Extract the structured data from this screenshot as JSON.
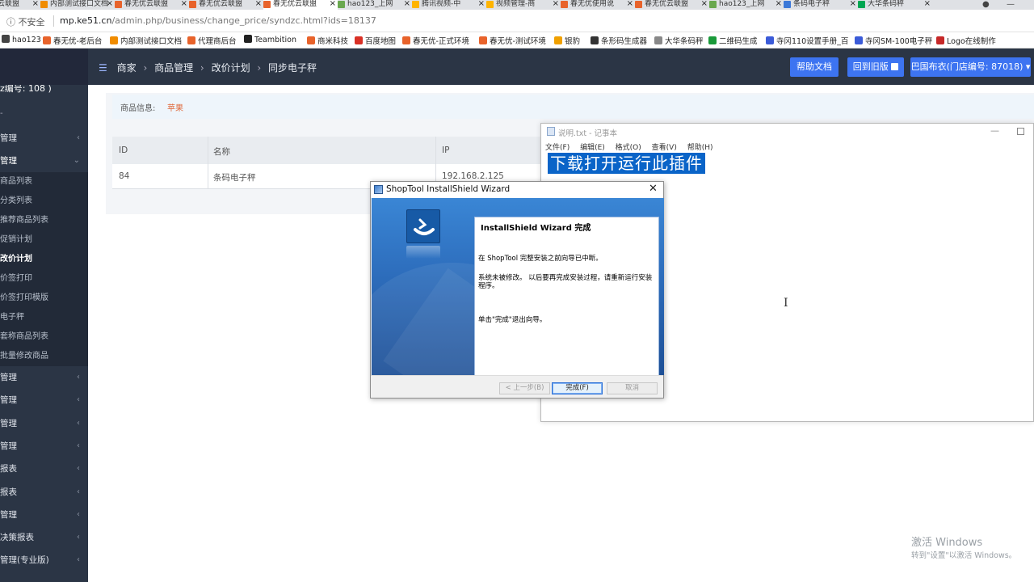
{
  "browser": {
    "tabs": [
      {
        "label": "春无优云联盟",
        "color": "#f08c00"
      },
      {
        "label": "内部测试接口文档",
        "color": "#f08c00"
      },
      {
        "label": "春无优云联盟",
        "color": "#e8632b"
      },
      {
        "label": "春无优云联盟",
        "color": "#e8632b"
      },
      {
        "label": "春无优云联盟",
        "color": "#e8632b",
        "active": true
      },
      {
        "label": "hao123_上网",
        "color": "#6aa84f"
      },
      {
        "label": "腾讯视频-中",
        "color": "#ffb400"
      },
      {
        "label": "视频管理-商",
        "color": "#ffb400"
      },
      {
        "label": "春无优使用说",
        "color": "#e8632b"
      },
      {
        "label": "春无优云联盟",
        "color": "#e8632b"
      },
      {
        "label": "hao123_上网",
        "color": "#6aa84f"
      },
      {
        "label": "条码电子秤",
        "color": "#3b78d8"
      },
      {
        "label": "大华条码秤",
        "color": "#00a651"
      }
    ],
    "address": {
      "security_label": "不安全",
      "url_host": "mp.ke51.cn",
      "url_path": "/admin.php/business/change_price/syndzc.html?ids=18137"
    },
    "bookmarks": [
      {
        "label": "hao123",
        "color": "#444"
      },
      {
        "label": "春无优-老后台",
        "color": "#e8632b"
      },
      {
        "label": "内部测试接口文档",
        "color": "#f08c00"
      },
      {
        "label": "代理商后台",
        "color": "#e8632b"
      },
      {
        "label": "Teambition",
        "color": "#222"
      },
      {
        "label": "商米科技",
        "color": "#e8632b"
      },
      {
        "label": "百度地图",
        "color": "#d93025"
      },
      {
        "label": "春无优-正式环境",
        "color": "#e8632b"
      },
      {
        "label": "春无优-测试环境",
        "color": "#e8632b"
      },
      {
        "label": "银豹",
        "color": "#f0a000"
      },
      {
        "label": "条形码生成器",
        "color": "#333"
      },
      {
        "label": "大华条码秤",
        "color": "#888"
      },
      {
        "label": "二维码生成",
        "color": "#1a9a3a"
      },
      {
        "label": "寺冈110设置手册_百",
        "color": "#3b5bd8"
      },
      {
        "label": "寺冈SM-100电子秤",
        "color": "#3b5bd8"
      },
      {
        "label": "Logo在线制作",
        "color": "#c62828"
      }
    ]
  },
  "header": {
    "breadcrumb": [
      "商家",
      "商品管理",
      "改价计划",
      "同步电子秤"
    ],
    "help_label": "帮助文档",
    "old_version_label": "回到旧版",
    "store_label": "巴国布衣(门店编号: 87018)"
  },
  "sidebar": {
    "store_id_label": "z编号: 108 )",
    "groups_top": [
      {
        "label": "管理"
      },
      {
        "label": "管理",
        "open": true
      }
    ],
    "sub_items": [
      {
        "label": "商品列表"
      },
      {
        "label": "分类列表"
      },
      {
        "label": "推荐商品列表"
      },
      {
        "label": "促销计划"
      },
      {
        "label": "改价计划",
        "active": true
      },
      {
        "label": "价签打印"
      },
      {
        "label": "价签打印模版"
      },
      {
        "label": "电子秤"
      },
      {
        "label": "套称商品列表"
      },
      {
        "label": "批量修改商品"
      }
    ],
    "groups_bottom": [
      {
        "label": "管理"
      },
      {
        "label": "管理"
      },
      {
        "label": "管理"
      },
      {
        "label": "管理"
      },
      {
        "label": "报表"
      },
      {
        "label": "报表"
      },
      {
        "label": "管理"
      },
      {
        "label": "决策报表"
      },
      {
        "label": "管理(专业版)"
      }
    ]
  },
  "main": {
    "product_info_label": "商品信息:",
    "product_info_value": "苹果",
    "table": {
      "columns": [
        "ID",
        "名称",
        "IP"
      ],
      "rows": [
        [
          "84",
          "条码电子秤",
          "192.168.2.125"
        ]
      ]
    }
  },
  "notepad": {
    "title": "说明.txt - 记事本",
    "menu": [
      "文件(F)",
      "编辑(E)",
      "格式(O)",
      "查看(V)",
      "帮助(H)"
    ],
    "content": "下载打开运行此插件"
  },
  "dialog": {
    "title": "ShopTool InstallShield Wizard",
    "heading": "InstallShield Wizard 完成",
    "paragraph1": "在 ShopTool 完整安装之前向导已中断。",
    "paragraph2": "系统未被修改。 以后要再完成安装过程，请重新运行安装程序。",
    "paragraph3": "单击\"完成\"退出向导。",
    "back_label": "< 上一步(B)",
    "finish_label": "完成(F)",
    "cancel_label": "取消"
  },
  "watermark": {
    "line1": "激活 Windows",
    "line2": "转到\"设置\"以激活 Windows。"
  }
}
